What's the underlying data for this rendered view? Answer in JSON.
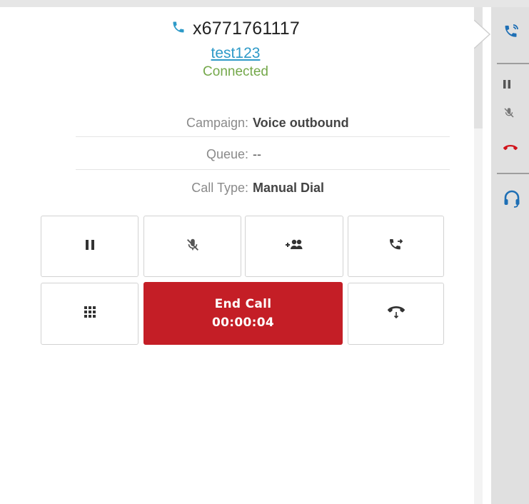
{
  "call": {
    "number": "x6771761117",
    "contact_name": "test123",
    "status": "Connected"
  },
  "details": {
    "campaign_label": "Campaign:",
    "campaign_value": "Voice outbound",
    "queue_label": "Queue:",
    "queue_value": "--",
    "call_type_label": "Call Type:",
    "call_type_value": "Manual Dial"
  },
  "controls": {
    "end_call_label": "End Call",
    "timer": "00:00:04",
    "buttons": [
      "pause-icon",
      "mute-mic-icon",
      "add-participant-icon",
      "transfer-call-icon",
      "dialpad-icon",
      "park-call-icon"
    ]
  },
  "side_rail": {
    "icons": [
      "active-call-icon",
      "pause-icon",
      "mute-mic-icon",
      "hangup-icon",
      "agent-headset-icon"
    ]
  },
  "colors": {
    "accent_blue": "#2e9ac8",
    "connected_green": "#74a84a",
    "end_call_red": "#c41e26",
    "hangup_red": "#d1131b"
  }
}
